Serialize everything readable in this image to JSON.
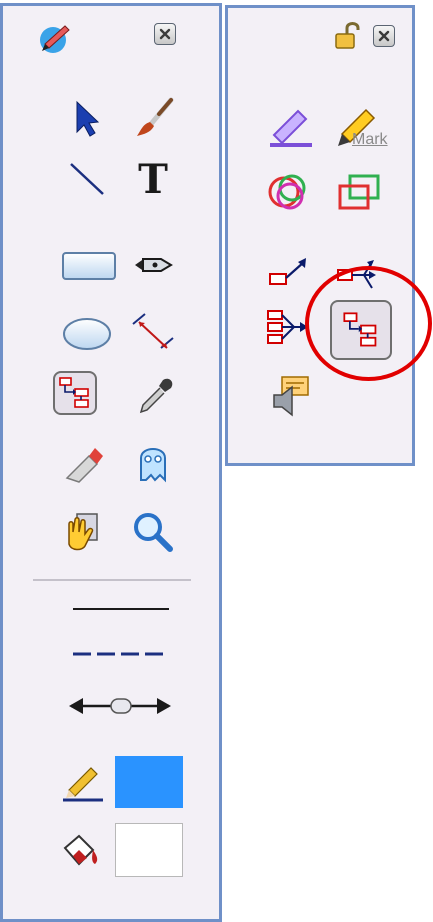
{
  "left_palette": {
    "title_icon": "pen-logo-icon",
    "close_icon": "close-icon",
    "tools": [
      {
        "name": "select-arrow-icon"
      },
      {
        "name": "paintbrush-icon"
      },
      {
        "name": "line-tool-icon"
      },
      {
        "name": "text-tool-icon",
        "glyph": "T"
      },
      {
        "name": "rectangle-tool-icon"
      },
      {
        "name": "pen-nib-icon"
      },
      {
        "name": "ellipse-tool-icon"
      },
      {
        "name": "dimension-line-icon"
      },
      {
        "name": "connector-tool-icon",
        "selected": true
      },
      {
        "name": "eyedropper-icon"
      },
      {
        "name": "eraser-icon"
      },
      {
        "name": "ghost-icon"
      },
      {
        "name": "hand-pan-icon"
      },
      {
        "name": "magnifier-icon"
      }
    ],
    "line_styles": [
      "solid-line-icon",
      "dashed-line-icon",
      "arrow-ends-icon"
    ],
    "stroke_color": "#2a93ff",
    "fill_color": "#ffffff"
  },
  "right_palette": {
    "lock_icon": "unlock-icon",
    "close_icon": "close-icon",
    "mark_label": "Mark",
    "tools": [
      {
        "name": "highlighter-icon"
      },
      {
        "name": "mark-pencil-icon"
      },
      {
        "name": "overlap-circles-icon"
      },
      {
        "name": "overlap-rectangles-icon"
      },
      {
        "name": "link-arrow-icon"
      },
      {
        "name": "fan-out-icon"
      },
      {
        "name": "fan-in-icon"
      },
      {
        "name": "connector-tool-icon",
        "selected": true,
        "annotated": true
      },
      {
        "name": "speaker-note-icon"
      }
    ]
  },
  "annotation_color": "#e10000"
}
